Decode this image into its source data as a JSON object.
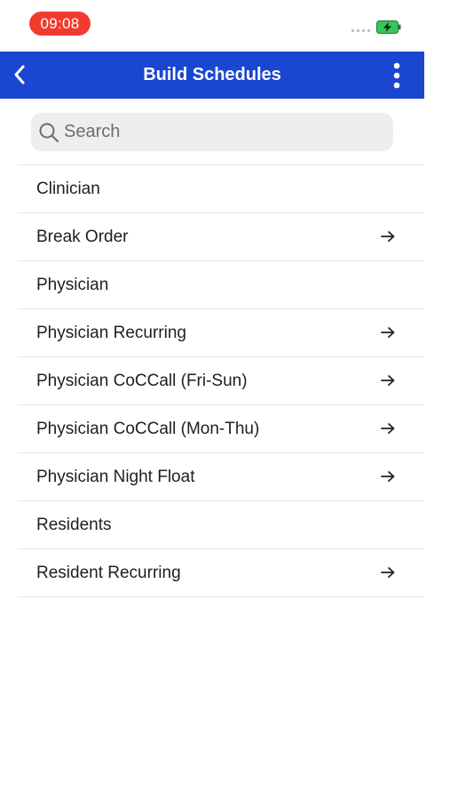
{
  "status_bar": {
    "time": "09:08",
    "time_pill_color": "#f23b2f",
    "battery_icon": "battery-charging-icon",
    "battery_color": "#34c759",
    "signal_icon": "signal-dots-icon"
  },
  "nav_bar": {
    "title": "Build Schedules",
    "background_color": "#1a46d1",
    "back_icon": "chevron-left-icon",
    "menu_icon": "vertical-ellipsis-icon"
  },
  "search": {
    "placeholder": "Search",
    "value": "",
    "icon": "search-icon"
  },
  "list": {
    "items": [
      {
        "label": "Clinician",
        "has_arrow": false
      },
      {
        "label": "Break Order",
        "has_arrow": true
      },
      {
        "label": "Physician",
        "has_arrow": false
      },
      {
        "label": "Physician Recurring",
        "has_arrow": true
      },
      {
        "label": "Physician CoCCall (Fri-Sun)",
        "has_arrow": true
      },
      {
        "label": "Physician CoCCall (Mon-Thu)",
        "has_arrow": true
      },
      {
        "label": "Physician Night Float",
        "has_arrow": true
      },
      {
        "label": "Residents",
        "has_arrow": false
      },
      {
        "label": "Resident Recurring",
        "has_arrow": true
      }
    ],
    "arrow_icon": "arrow-right-icon"
  }
}
